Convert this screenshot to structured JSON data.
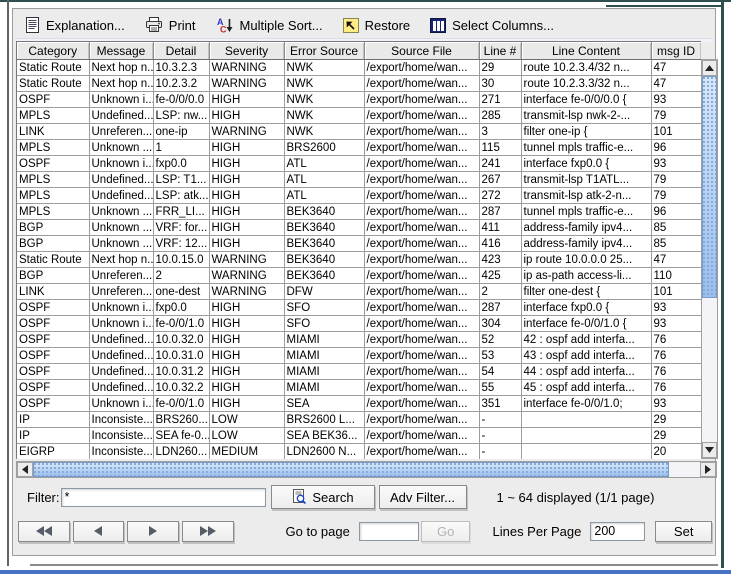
{
  "toolbar": {
    "buttons": [
      {
        "label": "Explanation...",
        "icon": "document-icon"
      },
      {
        "label": "Print",
        "icon": "printer-icon"
      },
      {
        "label": "Multiple Sort...",
        "icon": "multi-sort-icon"
      },
      {
        "label": "Restore",
        "icon": "restore-icon"
      },
      {
        "label": "Select Columns...",
        "icon": "select-columns-icon"
      }
    ]
  },
  "table": {
    "columns": [
      "Category",
      "Message",
      "Detail",
      "Severity",
      "Error Source",
      "Source File",
      "Line #",
      "Line Content",
      "msg ID"
    ],
    "rows": [
      [
        "Static Route",
        "Next hop n...",
        "10.3.2.3",
        "WARNING",
        "NWK",
        "/export/home/wan...",
        "29",
        "route 10.2.3.4/32 n...",
        "47"
      ],
      [
        "Static Route",
        "Next hop n...",
        "10.2.3.2",
        "WARNING",
        "NWK",
        "/export/home/wan...",
        "30",
        "route 10.2.3.3/32 n...",
        "47"
      ],
      [
        "OSPF",
        "Unknown i...",
        "fe-0/0/0.0",
        "HIGH",
        "NWK",
        "/export/home/wan...",
        "271",
        "interface fe-0/0/0.0 {",
        "93"
      ],
      [
        "MPLS",
        "Undefined...",
        "LSP: nw...",
        "HIGH",
        "NWK",
        "/export/home/wan...",
        "285",
        "transmit-lsp nwk-2-...",
        "79"
      ],
      [
        "LINK",
        "Unreferen...",
        "one-ip",
        "WARNING",
        "NWK",
        "/export/home/wan...",
        "3",
        "filter one-ip {",
        "101"
      ],
      [
        "MPLS",
        "Unknown ...",
        "1",
        "HIGH",
        "BRS2600",
        "/export/home/wan...",
        "115",
        "tunnel mpls traffic-e...",
        "96"
      ],
      [
        "OSPF",
        "Unknown i...",
        "fxp0.0",
        "HIGH",
        "ATL",
        "/export/home/wan...",
        "241",
        "interface fxp0.0 {",
        "93"
      ],
      [
        "MPLS",
        "Undefined...",
        "LSP: T1...",
        "HIGH",
        "ATL",
        "/export/home/wan...",
        "267",
        "transmit-lsp T1ATL...",
        "79"
      ],
      [
        "MPLS",
        "Undefined...",
        "LSP: atk...",
        "HIGH",
        "ATL",
        "/export/home/wan...",
        "272",
        "transmit-lsp atk-2-n...",
        "79"
      ],
      [
        "MPLS",
        "Unknown ...",
        "FRR_LI...",
        "HIGH",
        "BEK3640",
        "/export/home/wan...",
        "287",
        "tunnel mpls traffic-e...",
        "96"
      ],
      [
        "BGP",
        "Unknown ...",
        "VRF: for...",
        "HIGH",
        "BEK3640",
        "/export/home/wan...",
        "411",
        "address-family ipv4...",
        "85"
      ],
      [
        "BGP",
        "Unknown ...",
        "VRF: 12...",
        "HIGH",
        "BEK3640",
        "/export/home/wan...",
        "416",
        "address-family ipv4...",
        "85"
      ],
      [
        "Static Route",
        "Next hop n...",
        "10.0.15.0",
        "WARNING",
        "BEK3640",
        "/export/home/wan...",
        "423",
        "ip route 10.0.0.0 25...",
        "47"
      ],
      [
        "BGP",
        "Unreferen...",
        "2",
        "WARNING",
        "BEK3640",
        "/export/home/wan...",
        "425",
        "ip as-path access-li...",
        "110"
      ],
      [
        "LINK",
        "Unreferen...",
        "one-dest",
        "WARNING",
        "DFW",
        "/export/home/wan...",
        "2",
        "filter one-dest {",
        "101"
      ],
      [
        "OSPF",
        "Unknown i...",
        "fxp0.0",
        "HIGH",
        "SFO",
        "/export/home/wan...",
        "287",
        "interface fxp0.0 {",
        "93"
      ],
      [
        "OSPF",
        "Unknown i...",
        "fe-0/0/1.0",
        "HIGH",
        "SFO",
        "/export/home/wan...",
        "304",
        "interface fe-0/0/1.0 {",
        "93"
      ],
      [
        "OSPF",
        "Undefined...",
        "10.0.32.0",
        "HIGH",
        "MIAMI",
        "/export/home/wan...",
        "52",
        "42 : ospf add interfa...",
        "76"
      ],
      [
        "OSPF",
        "Undefined...",
        "10.0.31.0",
        "HIGH",
        "MIAMI",
        "/export/home/wan...",
        "53",
        "43 : ospf add interfa...",
        "76"
      ],
      [
        "OSPF",
        "Undefined...",
        "10.0.31.2",
        "HIGH",
        "MIAMI",
        "/export/home/wan...",
        "54",
        "44 : ospf add interfa...",
        "76"
      ],
      [
        "OSPF",
        "Undefined...",
        "10.0.32.2",
        "HIGH",
        "MIAMI",
        "/export/home/wan...",
        "55",
        "45 : ospf add interfa...",
        "76"
      ],
      [
        "OSPF",
        "Unknown i...",
        "fe-0/0/1.0",
        "HIGH",
        "SEA",
        "/export/home/wan...",
        "351",
        "interface fe-0/0/1.0;",
        "93"
      ],
      [
        "IP",
        "Inconsiste...",
        "BRS260...",
        "LOW",
        "BRS2600 L...",
        "/export/home/wan...",
        "-",
        "",
        "29"
      ],
      [
        "IP",
        "Inconsiste...",
        "SEA fe-0...",
        "LOW",
        "SEA BEK36...",
        "/export/home/wan...",
        "-",
        "",
        "29"
      ],
      [
        "EIGRP",
        "Inconsiste...",
        "LDN260...",
        "MEDIUM",
        "LDN2600 N...",
        "/export/home/wan...",
        "-",
        "",
        "20"
      ]
    ]
  },
  "filter_bar": {
    "label": "Filter:",
    "value": "*",
    "search_label": "Search",
    "adv_filter_label": "Adv Filter...",
    "status": "1 ~ 64 displayed (1/1 page)"
  },
  "pagination": {
    "go_to_page_label": "Go to page",
    "page_value": "",
    "go_label": "Go",
    "lines_per_page_label": "Lines Per Page",
    "lines_per_page_value": "200",
    "set_label": "Set"
  },
  "colors": {
    "frame_top": "#2F4F4F",
    "window_bottom_accent": "#4A72C4",
    "scrollbar_thumb": "#A9C7EF"
  }
}
